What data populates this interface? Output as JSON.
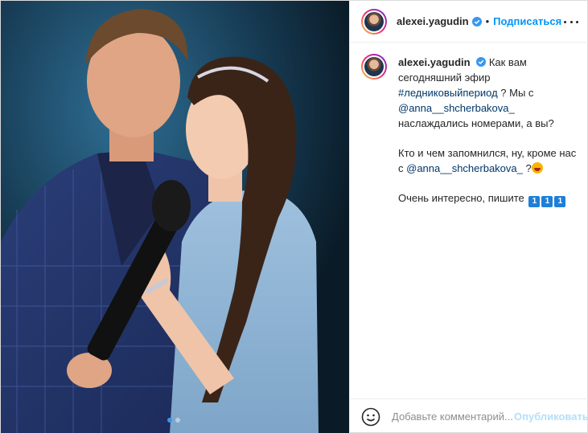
{
  "post": {
    "username": "alexei.yagudin",
    "follow_label": "Подписаться",
    "separator": "•",
    "icons": {
      "verified": "verified-badge-icon",
      "more": "more-options-icon",
      "emoji": "emoji-smile-icon"
    },
    "colors": {
      "link": "#0095f6",
      "mention": "#00376b",
      "verified": "#3897f0"
    }
  },
  "caption": {
    "line1": " Как вам сегодняшний эфир ",
    "hashtag": "#ледниковыйпериод",
    "line2": " ? Мы с ",
    "mention1": "@anna__shcherbakova_",
    "line3": " наслаждались номерами, а вы?",
    "para2_text": "Кто и чем запомнился, ну, кроме нас с ",
    "mention2": "@anna__shcherbakova_",
    "para2_end": " ?",
    "para3_text": "Очень интересно, пишите ",
    "keycap": "1"
  },
  "comment": {
    "placeholder": "Добавьте комментарий...",
    "publish_label": "Опубликовать"
  },
  "carousel": {
    "count": 2,
    "active_index": 0
  }
}
